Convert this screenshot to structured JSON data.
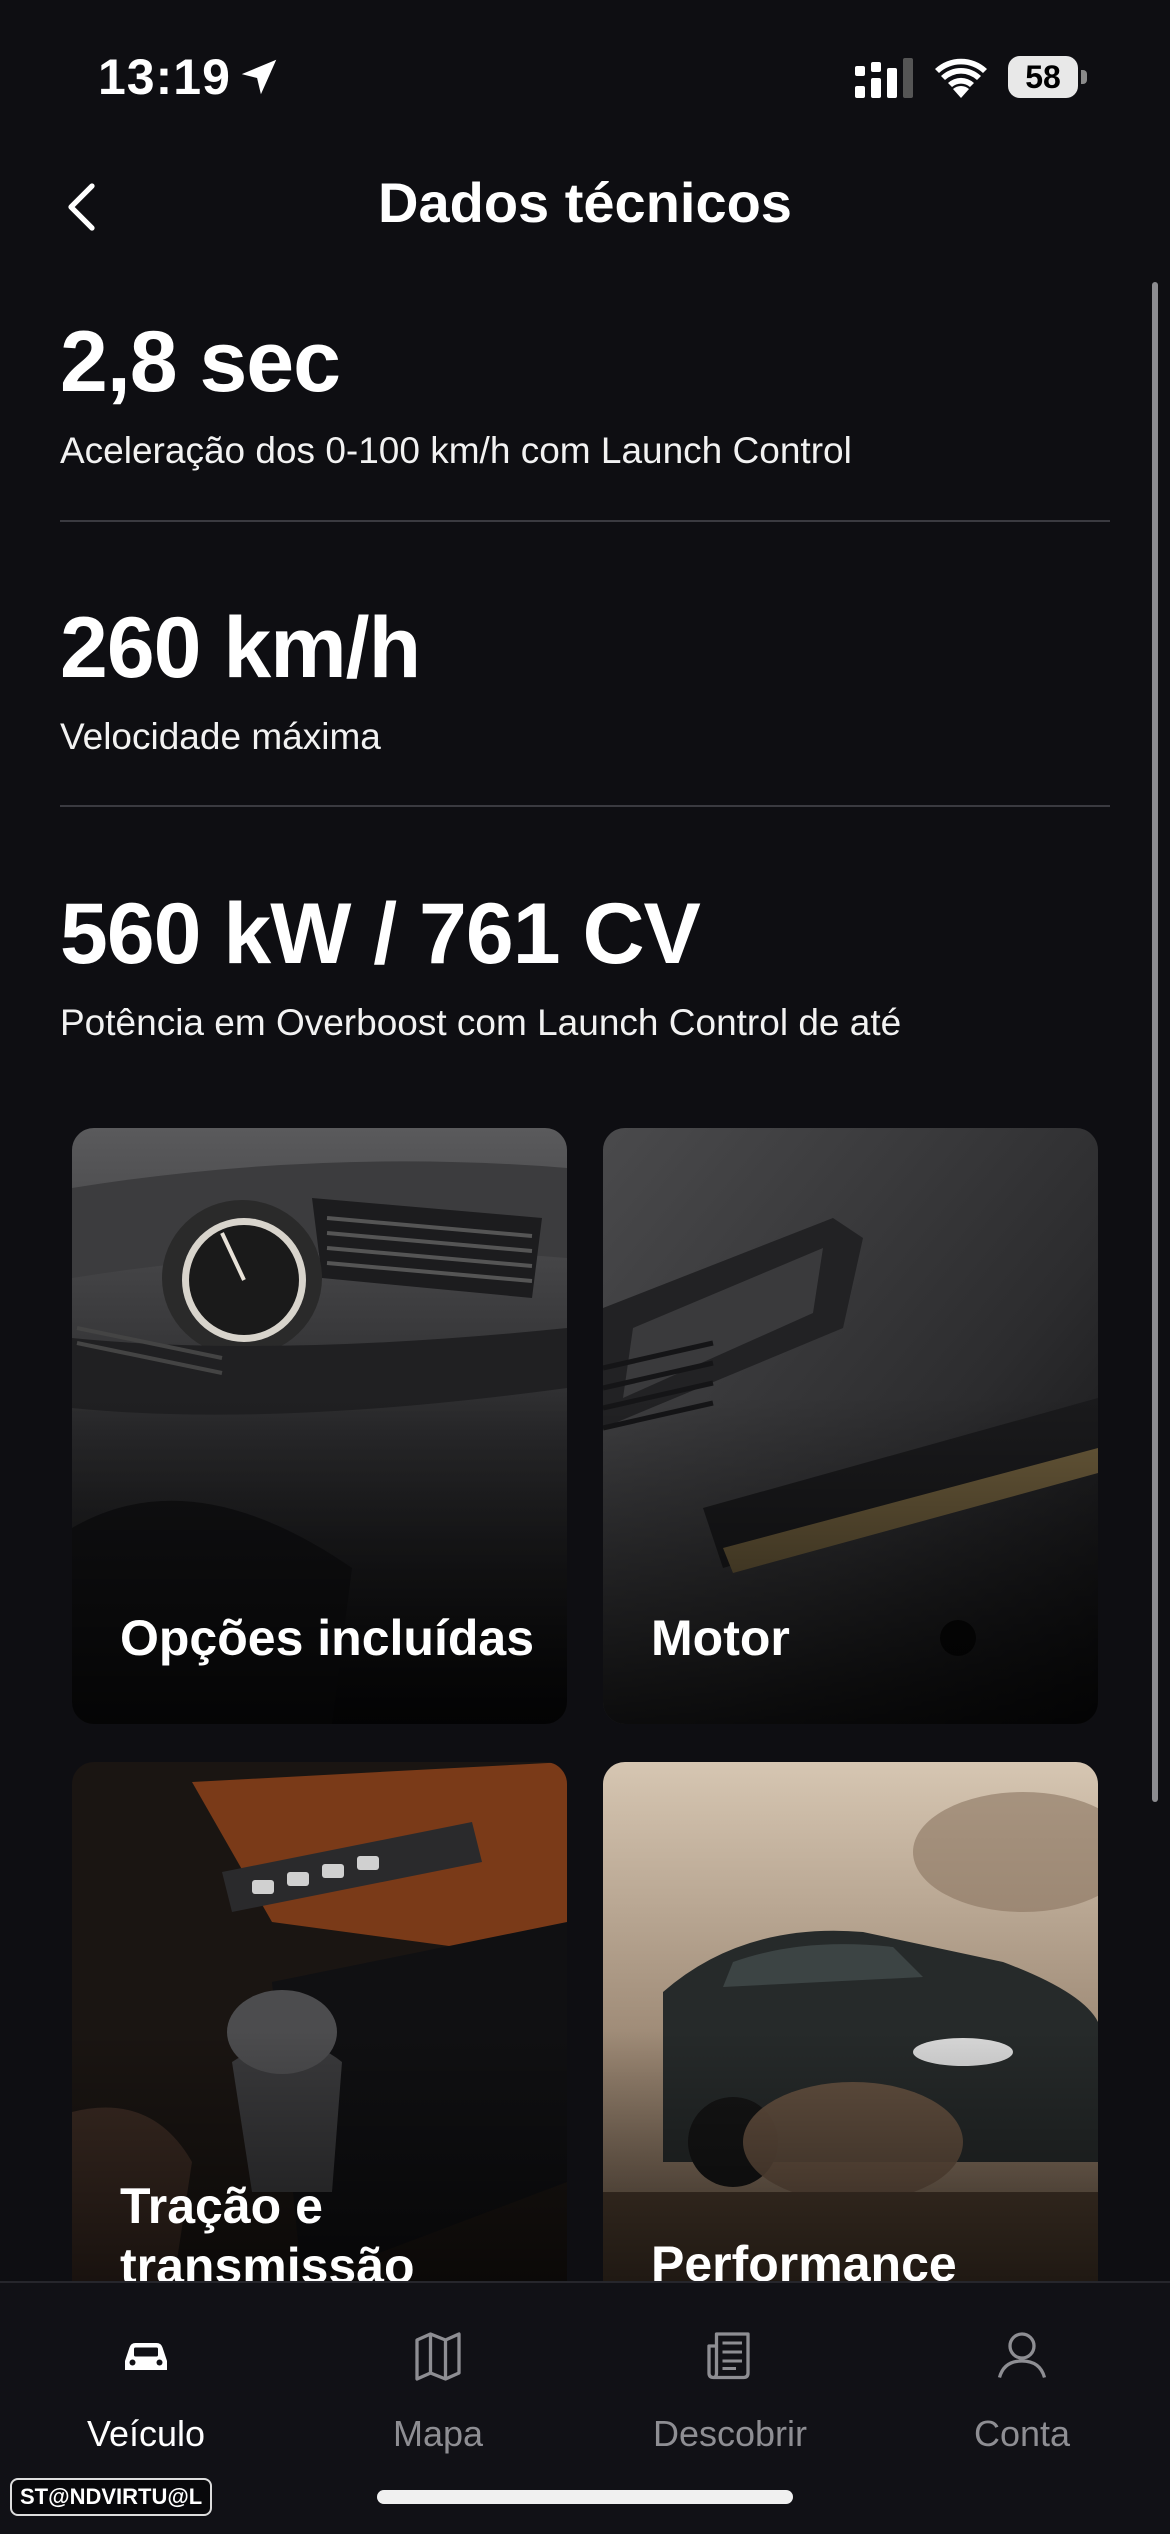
{
  "status_bar": {
    "time": "13:19",
    "battery": "58",
    "icons": [
      "location-arrow-icon",
      "signal-icon",
      "wifi-icon",
      "battery-icon"
    ]
  },
  "header": {
    "title": "Dados técnicos",
    "back_icon": "chevron-left-icon"
  },
  "specs": [
    {
      "value": "2,8 sec",
      "label": "Aceleração dos 0-100 km/h com Launch Control"
    },
    {
      "value": "260 km/h",
      "label": "Velocidade máxima"
    },
    {
      "value": "560 kW / 761 CV",
      "label": "Potência em Overboost com Launch Control de até"
    }
  ],
  "tiles": [
    {
      "label": "Opções incluídas",
      "image": "dashboard-clock-photo"
    },
    {
      "label": "Motor",
      "image": "engine-cover-photo"
    },
    {
      "label": "Tração e transmissão",
      "image": "gear-shifter-photo"
    },
    {
      "label": "Performance",
      "image": "car-offroad-dust-photo"
    }
  ],
  "tab_bar": {
    "active": "Veículo",
    "items": [
      {
        "label": "Veículo",
        "icon": "car-icon"
      },
      {
        "label": "Mapa",
        "icon": "map-icon"
      },
      {
        "label": "Descobrir",
        "icon": "news-icon"
      },
      {
        "label": "Conta",
        "icon": "user-icon"
      }
    ]
  },
  "watermark": "ST@NDVIRTU@L",
  "colors": {
    "background": "#0e0e12",
    "text": "#ffffff",
    "inactive_tab": "#8e8e93",
    "divider": "#3a3a40"
  }
}
